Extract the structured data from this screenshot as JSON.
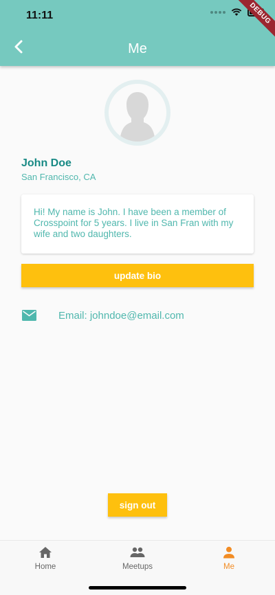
{
  "status_bar": {
    "time": "11:11",
    "debug_label": "DEBUG"
  },
  "app_bar": {
    "title": "Me"
  },
  "profile": {
    "name": "John Doe",
    "location": "San Francisco, CA",
    "bio": "Hi!  My name is John.  I have been a member of Crosspoint for 5 years.  I live in San Fran with my wife and two daughters."
  },
  "buttons": {
    "update_bio": "update bio",
    "sign_out": "sign out"
  },
  "contact": {
    "email_text": "Email: johndoe@email.com"
  },
  "bottom_nav": {
    "items": [
      {
        "label": "Home",
        "icon": "home-icon",
        "active": false
      },
      {
        "label": "Meetups",
        "icon": "people-icon",
        "active": false
      },
      {
        "label": "Me",
        "icon": "person-icon",
        "active": true
      }
    ]
  },
  "colors": {
    "app_bar": "#76c9bf",
    "accent_text": "#4fb7ad",
    "name_text": "#198a85",
    "button": "#fec00e",
    "active_tab": "#f28c24"
  }
}
